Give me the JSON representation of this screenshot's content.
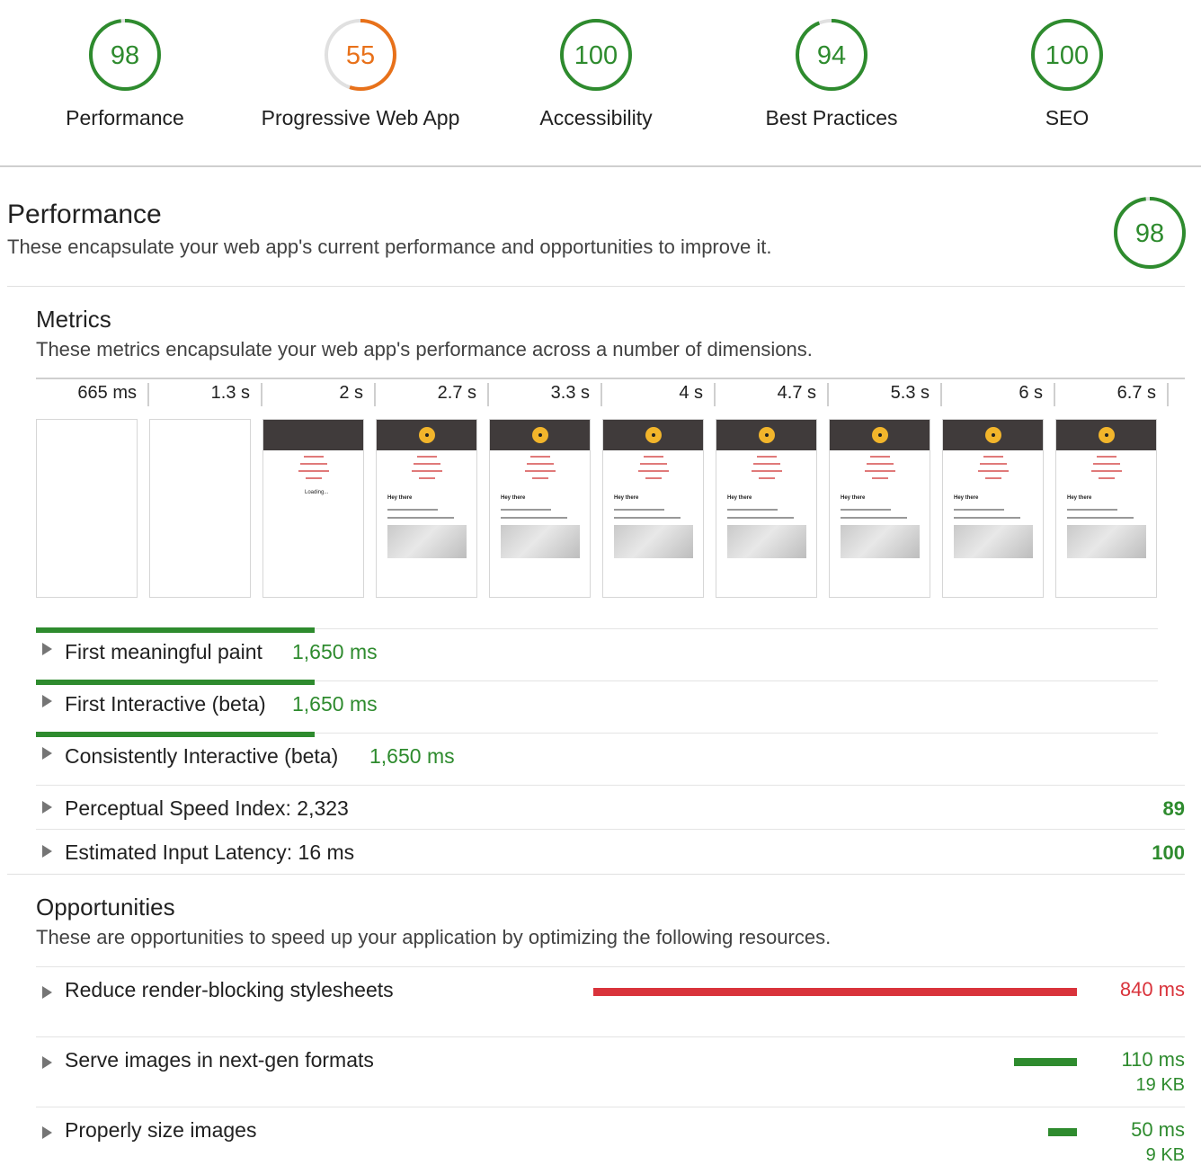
{
  "categories": [
    {
      "score": "98",
      "label": "Performance",
      "fraction": 0.98,
      "color": "#2e8b2e"
    },
    {
      "score": "55",
      "label": "Progressive Web App",
      "fraction": 0.55,
      "color": "#e8711a"
    },
    {
      "score": "100",
      "label": "Accessibility",
      "fraction": 1.0,
      "color": "#2e8b2e"
    },
    {
      "score": "94",
      "label": "Best Practices",
      "fraction": 0.94,
      "color": "#2e8b2e"
    },
    {
      "score": "100",
      "label": "SEO",
      "fraction": 1.0,
      "color": "#2e8b2e"
    }
  ],
  "performance": {
    "title": "Performance",
    "description": "These encapsulate your web app's current performance and opportunities to improve it.",
    "score": "98",
    "fraction": 0.98
  },
  "metrics": {
    "title": "Metrics",
    "description": "These metrics encapsulate your web app's performance across a number of dimensions.",
    "timeline": [
      "665 ms",
      "1.3 s",
      "2 s",
      "2.7 s",
      "3.3 s",
      "4 s",
      "4.7 s",
      "5.3 s",
      "6 s",
      "6.7 s"
    ],
    "frames": [
      "blank",
      "blank",
      "loading",
      "full",
      "full",
      "full",
      "full",
      "full",
      "full",
      "full"
    ],
    "frame_text": {
      "heading": "Hey there",
      "loading": "Loading..."
    },
    "timed": [
      {
        "name": "First meaningful paint",
        "value": "1,650 ms"
      },
      {
        "name": "First Interactive (beta)",
        "value": "1,650 ms"
      },
      {
        "name": "Consistently Interactive (beta)",
        "value": "1,650 ms"
      }
    ],
    "scored": [
      {
        "name": "Perceptual Speed Index: 2,323",
        "score": "89"
      },
      {
        "name": "Estimated Input Latency: 16 ms",
        "score": "100"
      }
    ]
  },
  "opportunities": {
    "title": "Opportunities",
    "description": "These are opportunities to speed up your application by optimizing the following resources.",
    "items": [
      {
        "name": "Reduce render-blocking stylesheets",
        "time": "840 ms",
        "size": "",
        "ms": 840,
        "color": "#d9333b"
      },
      {
        "name": "Serve images in next-gen formats",
        "time": "110 ms",
        "size": "19 KB",
        "ms": 110,
        "color": "#2e8b2e"
      },
      {
        "name": "Properly size images",
        "time": "50 ms",
        "size": "9 KB",
        "ms": 50,
        "color": "#2e8b2e"
      }
    ]
  },
  "colors": {
    "pass": "#2e8b2e",
    "average": "#e8711a",
    "fail": "#d9333b"
  }
}
